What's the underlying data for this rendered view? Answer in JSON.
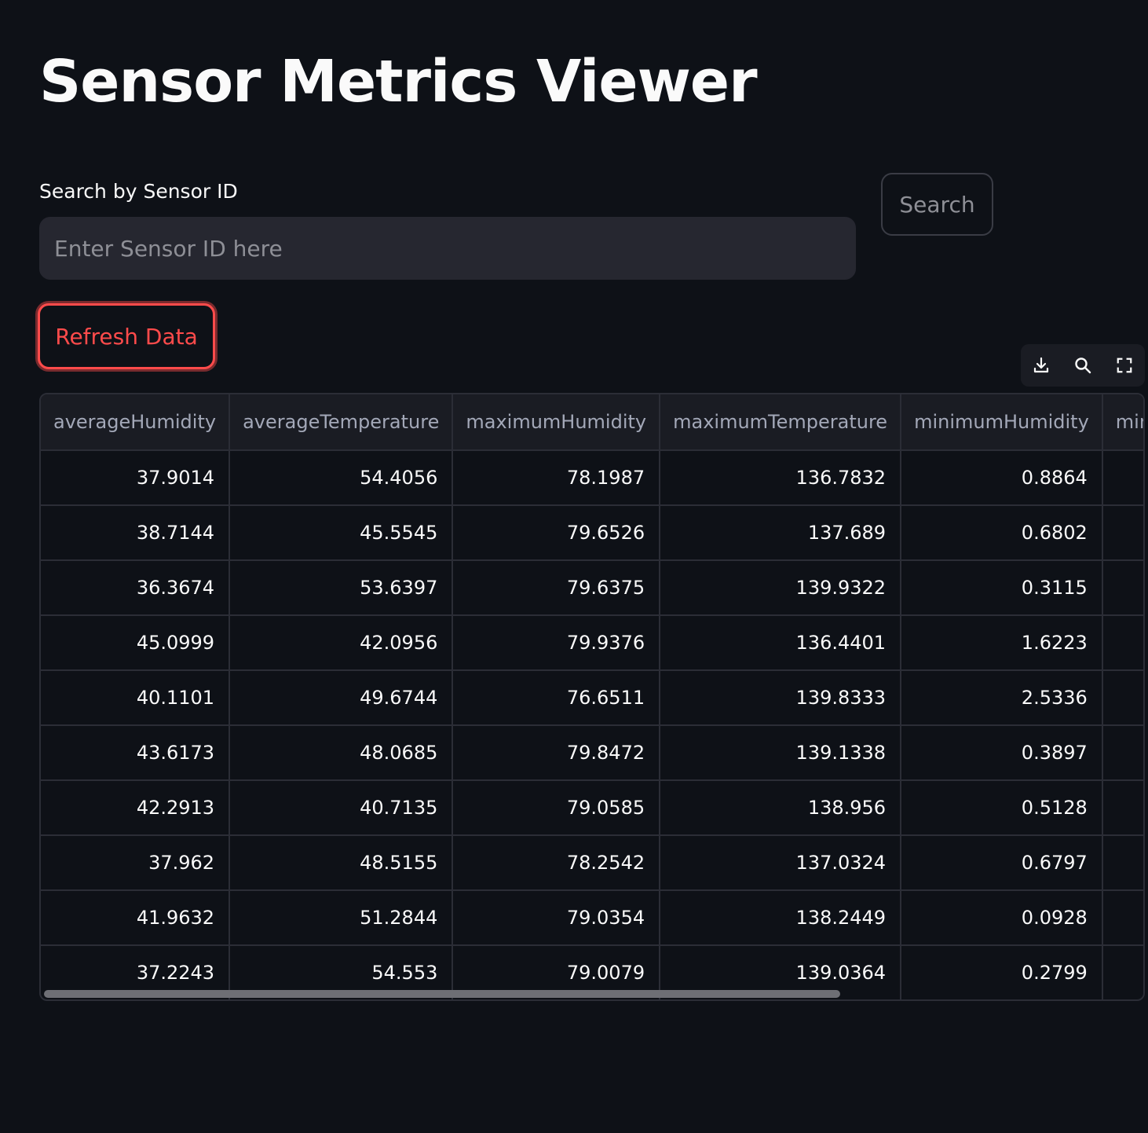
{
  "page": {
    "title": "Sensor Metrics Viewer"
  },
  "search": {
    "label": "Search by Sensor ID",
    "placeholder": "Enter Sensor ID here",
    "value": "",
    "button_label": "Search"
  },
  "refresh": {
    "label": "Refresh Data"
  },
  "colors": {
    "background": "#0e1117",
    "accent": "#ff4b4b",
    "input_bg": "#262730",
    "header_bg": "#1a1c23"
  },
  "toolbar": {
    "icons": [
      "download-icon",
      "search-icon",
      "fullscreen-icon"
    ]
  },
  "table": {
    "columns": [
      "averageHumidity",
      "averageTemperature",
      "maximumHumidity",
      "maximumTemperature",
      "minimumHumidity",
      "minimumTemperature"
    ],
    "rows": [
      [
        "37.9014",
        "54.4056",
        "78.1987",
        "136.7832",
        "0.8864",
        ""
      ],
      [
        "38.7144",
        "45.5545",
        "79.6526",
        "137.689",
        "0.6802",
        ""
      ],
      [
        "36.3674",
        "53.6397",
        "79.6375",
        "139.9322",
        "0.3115",
        ""
      ],
      [
        "45.0999",
        "42.0956",
        "79.9376",
        "136.4401",
        "1.6223",
        ""
      ],
      [
        "40.1101",
        "49.6744",
        "76.6511",
        "139.8333",
        "2.5336",
        ""
      ],
      [
        "43.6173",
        "48.0685",
        "79.8472",
        "139.1338",
        "0.3897",
        ""
      ],
      [
        "42.2913",
        "40.7135",
        "79.0585",
        "138.956",
        "0.5128",
        ""
      ],
      [
        "37.962",
        "48.5155",
        "78.2542",
        "137.0324",
        "0.6797",
        ""
      ],
      [
        "41.9632",
        "51.2844",
        "79.0354",
        "138.2449",
        "0.0928",
        ""
      ],
      [
        "37.2243",
        "54.553",
        "79.0079",
        "139.0364",
        "0.2799",
        ""
      ]
    ]
  }
}
